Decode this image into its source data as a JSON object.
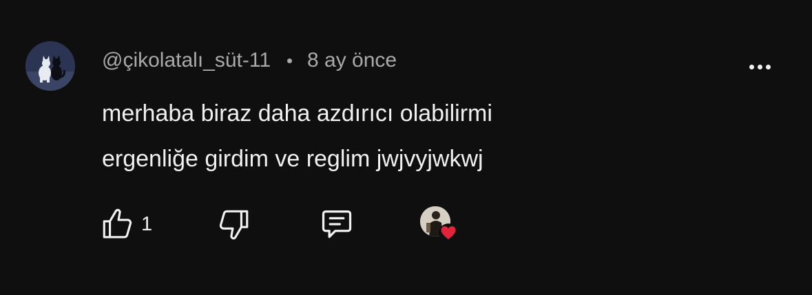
{
  "comment": {
    "author": "@çikolatalı_süt-11",
    "separator": "•",
    "timestamp": "8 ay önce",
    "text_lines": [
      "merhaba biraz daha azdırıcı olabilirmi",
      "ergenliğe girdim ve reglim jwjvyjwkwj"
    ],
    "like_count": "1"
  },
  "icons": {
    "author_avatar": "cats-avatar",
    "more": "more-vertical-icon",
    "like": "thumbs-up-icon",
    "dislike": "thumbs-down-icon",
    "reply": "comment-reply-icon",
    "creator_heart": "creator-heart-icon"
  },
  "colors": {
    "background": "#0f0f0f",
    "primary_text": "#f1f1f1",
    "secondary_text": "#aaaaaa",
    "heart": "#e0243b"
  }
}
